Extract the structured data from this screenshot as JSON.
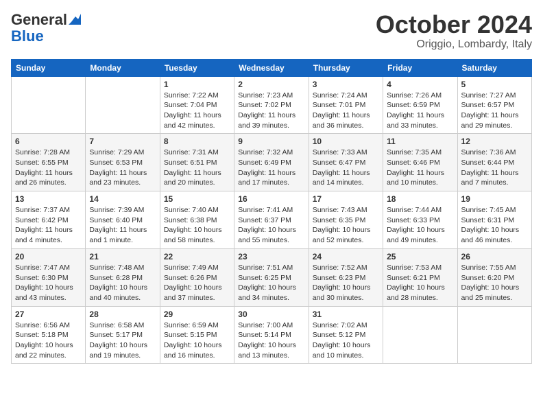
{
  "header": {
    "logo_line1": "General",
    "logo_line2": "Blue",
    "month": "October 2024",
    "location": "Origgio, Lombardy, Italy"
  },
  "weekdays": [
    "Sunday",
    "Monday",
    "Tuesday",
    "Wednesday",
    "Thursday",
    "Friday",
    "Saturday"
  ],
  "weeks": [
    [
      {
        "day": "",
        "sunrise": "",
        "sunset": "",
        "daylight": ""
      },
      {
        "day": "",
        "sunrise": "",
        "sunset": "",
        "daylight": ""
      },
      {
        "day": "1",
        "sunrise": "Sunrise: 7:22 AM",
        "sunset": "Sunset: 7:04 PM",
        "daylight": "Daylight: 11 hours and 42 minutes."
      },
      {
        "day": "2",
        "sunrise": "Sunrise: 7:23 AM",
        "sunset": "Sunset: 7:02 PM",
        "daylight": "Daylight: 11 hours and 39 minutes."
      },
      {
        "day": "3",
        "sunrise": "Sunrise: 7:24 AM",
        "sunset": "Sunset: 7:01 PM",
        "daylight": "Daylight: 11 hours and 36 minutes."
      },
      {
        "day": "4",
        "sunrise": "Sunrise: 7:26 AM",
        "sunset": "Sunset: 6:59 PM",
        "daylight": "Daylight: 11 hours and 33 minutes."
      },
      {
        "day": "5",
        "sunrise": "Sunrise: 7:27 AM",
        "sunset": "Sunset: 6:57 PM",
        "daylight": "Daylight: 11 hours and 29 minutes."
      }
    ],
    [
      {
        "day": "6",
        "sunrise": "Sunrise: 7:28 AM",
        "sunset": "Sunset: 6:55 PM",
        "daylight": "Daylight: 11 hours and 26 minutes."
      },
      {
        "day": "7",
        "sunrise": "Sunrise: 7:29 AM",
        "sunset": "Sunset: 6:53 PM",
        "daylight": "Daylight: 11 hours and 23 minutes."
      },
      {
        "day": "8",
        "sunrise": "Sunrise: 7:31 AM",
        "sunset": "Sunset: 6:51 PM",
        "daylight": "Daylight: 11 hours and 20 minutes."
      },
      {
        "day": "9",
        "sunrise": "Sunrise: 7:32 AM",
        "sunset": "Sunset: 6:49 PM",
        "daylight": "Daylight: 11 hours and 17 minutes."
      },
      {
        "day": "10",
        "sunrise": "Sunrise: 7:33 AM",
        "sunset": "Sunset: 6:47 PM",
        "daylight": "Daylight: 11 hours and 14 minutes."
      },
      {
        "day": "11",
        "sunrise": "Sunrise: 7:35 AM",
        "sunset": "Sunset: 6:46 PM",
        "daylight": "Daylight: 11 hours and 10 minutes."
      },
      {
        "day": "12",
        "sunrise": "Sunrise: 7:36 AM",
        "sunset": "Sunset: 6:44 PM",
        "daylight": "Daylight: 11 hours and 7 minutes."
      }
    ],
    [
      {
        "day": "13",
        "sunrise": "Sunrise: 7:37 AM",
        "sunset": "Sunset: 6:42 PM",
        "daylight": "Daylight: 11 hours and 4 minutes."
      },
      {
        "day": "14",
        "sunrise": "Sunrise: 7:39 AM",
        "sunset": "Sunset: 6:40 PM",
        "daylight": "Daylight: 11 hours and 1 minute."
      },
      {
        "day": "15",
        "sunrise": "Sunrise: 7:40 AM",
        "sunset": "Sunset: 6:38 PM",
        "daylight": "Daylight: 10 hours and 58 minutes."
      },
      {
        "day": "16",
        "sunrise": "Sunrise: 7:41 AM",
        "sunset": "Sunset: 6:37 PM",
        "daylight": "Daylight: 10 hours and 55 minutes."
      },
      {
        "day": "17",
        "sunrise": "Sunrise: 7:43 AM",
        "sunset": "Sunset: 6:35 PM",
        "daylight": "Daylight: 10 hours and 52 minutes."
      },
      {
        "day": "18",
        "sunrise": "Sunrise: 7:44 AM",
        "sunset": "Sunset: 6:33 PM",
        "daylight": "Daylight: 10 hours and 49 minutes."
      },
      {
        "day": "19",
        "sunrise": "Sunrise: 7:45 AM",
        "sunset": "Sunset: 6:31 PM",
        "daylight": "Daylight: 10 hours and 46 minutes."
      }
    ],
    [
      {
        "day": "20",
        "sunrise": "Sunrise: 7:47 AM",
        "sunset": "Sunset: 6:30 PM",
        "daylight": "Daylight: 10 hours and 43 minutes."
      },
      {
        "day": "21",
        "sunrise": "Sunrise: 7:48 AM",
        "sunset": "Sunset: 6:28 PM",
        "daylight": "Daylight: 10 hours and 40 minutes."
      },
      {
        "day": "22",
        "sunrise": "Sunrise: 7:49 AM",
        "sunset": "Sunset: 6:26 PM",
        "daylight": "Daylight: 10 hours and 37 minutes."
      },
      {
        "day": "23",
        "sunrise": "Sunrise: 7:51 AM",
        "sunset": "Sunset: 6:25 PM",
        "daylight": "Daylight: 10 hours and 34 minutes."
      },
      {
        "day": "24",
        "sunrise": "Sunrise: 7:52 AM",
        "sunset": "Sunset: 6:23 PM",
        "daylight": "Daylight: 10 hours and 30 minutes."
      },
      {
        "day": "25",
        "sunrise": "Sunrise: 7:53 AM",
        "sunset": "Sunset: 6:21 PM",
        "daylight": "Daylight: 10 hours and 28 minutes."
      },
      {
        "day": "26",
        "sunrise": "Sunrise: 7:55 AM",
        "sunset": "Sunset: 6:20 PM",
        "daylight": "Daylight: 10 hours and 25 minutes."
      }
    ],
    [
      {
        "day": "27",
        "sunrise": "Sunrise: 6:56 AM",
        "sunset": "Sunset: 5:18 PM",
        "daylight": "Daylight: 10 hours and 22 minutes."
      },
      {
        "day": "28",
        "sunrise": "Sunrise: 6:58 AM",
        "sunset": "Sunset: 5:17 PM",
        "daylight": "Daylight: 10 hours and 19 minutes."
      },
      {
        "day": "29",
        "sunrise": "Sunrise: 6:59 AM",
        "sunset": "Sunset: 5:15 PM",
        "daylight": "Daylight: 10 hours and 16 minutes."
      },
      {
        "day": "30",
        "sunrise": "Sunrise: 7:00 AM",
        "sunset": "Sunset: 5:14 PM",
        "daylight": "Daylight: 10 hours and 13 minutes."
      },
      {
        "day": "31",
        "sunrise": "Sunrise: 7:02 AM",
        "sunset": "Sunset: 5:12 PM",
        "daylight": "Daylight: 10 hours and 10 minutes."
      },
      {
        "day": "",
        "sunrise": "",
        "sunset": "",
        "daylight": ""
      },
      {
        "day": "",
        "sunrise": "",
        "sunset": "",
        "daylight": ""
      }
    ]
  ]
}
